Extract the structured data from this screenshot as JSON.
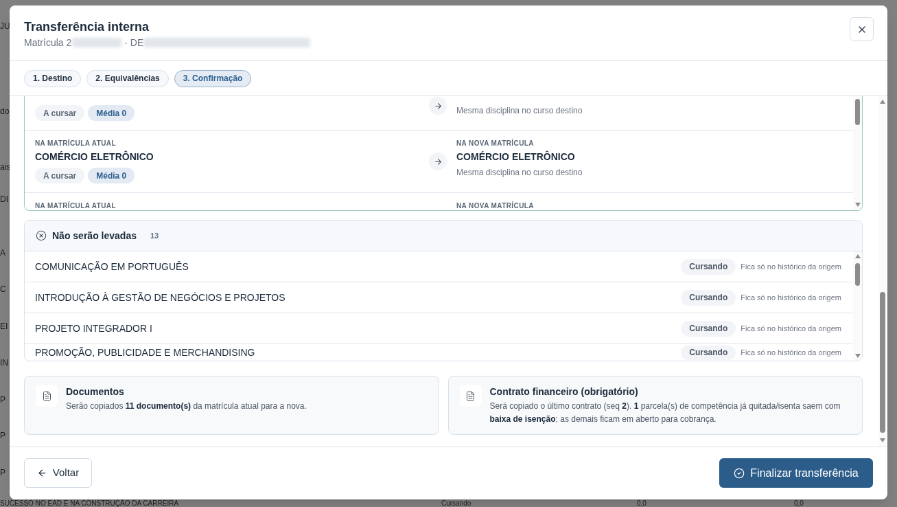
{
  "background_page": {
    "fragments": [
      "JU",
      "do",
      "ais",
      "DI",
      "A",
      "C",
      "EI",
      "IN",
      "P",
      "P",
      "P"
    ],
    "bottom_row": [
      "SUCESSO NO EAD E NA CONSTRUÇÃO DA CARREIRA",
      "Cursando",
      "0,0",
      "0,0"
    ]
  },
  "dialog": {
    "title": "Transferência interna",
    "subtitle_prefix": "Matrícula 2",
    "subtitle_separator": "· DE"
  },
  "steps": [
    {
      "label": "1. Destino",
      "selected": false
    },
    {
      "label": "2. Equivalências",
      "selected": false
    },
    {
      "label": "3. Confirmação",
      "selected": true
    }
  ],
  "equivalences": [
    {
      "current": {
        "tags": [
          {
            "text": "A cursar",
            "kind": "status"
          },
          {
            "text": "Média 0",
            "kind": "grade"
          }
        ]
      },
      "target": {
        "note": "Mesma disciplina no curso destino"
      }
    },
    {
      "current": {
        "label": "NA MATRÍCULA ATUAL",
        "course": "COMÉRCIO ELETRÔNICO",
        "tags": [
          {
            "text": "A cursar",
            "kind": "status"
          },
          {
            "text": "Média 0",
            "kind": "grade"
          }
        ]
      },
      "target": {
        "label": "NA NOVA MATRÍCULA",
        "course": "COMÉRCIO ELETRÔNICO",
        "note": "Mesma disciplina no curso destino"
      }
    },
    {
      "current": {
        "label": "NA MATRÍCULA ATUAL"
      },
      "target": {
        "label": "NA NOVA MATRÍCULA"
      }
    }
  ],
  "not_carried": {
    "title": "Não serão levadas",
    "count": "13",
    "rows": [
      {
        "name": "COMUNICAÇÃO EM PORTUGUÊS",
        "status": "Cursando",
        "note": "Fica só no histórico da origem"
      },
      {
        "name": "INTRODUÇÃO À GESTÃO DE NEGÓCIOS E PROJETOS",
        "status": "Cursando",
        "note": "Fica só no histórico da origem"
      },
      {
        "name": "PROJETO INTEGRADOR I",
        "status": "Cursando",
        "note": "Fica só no histórico da origem"
      },
      {
        "name": "PROMOÇÃO, PUBLICIDADE E MERCHANDISING",
        "status": "Cursando",
        "note": "Fica só no histórico da origem"
      }
    ]
  },
  "summary_cards": [
    {
      "title": "Documentos",
      "text": "Serão copiados **11 documento(s)** da matrícula atual para a nova."
    },
    {
      "title": "Contrato financeiro (obrigatório)",
      "text": "Será copiado o último contrato (seq **2**). **1** parcela(s) de competência já quitada/isenta saem com **baixa de isenção**; as demais ficam em aberto para cobrança."
    }
  ],
  "footer": {
    "back_button": "Voltar",
    "finish_button": "Finalizar transferência"
  }
}
